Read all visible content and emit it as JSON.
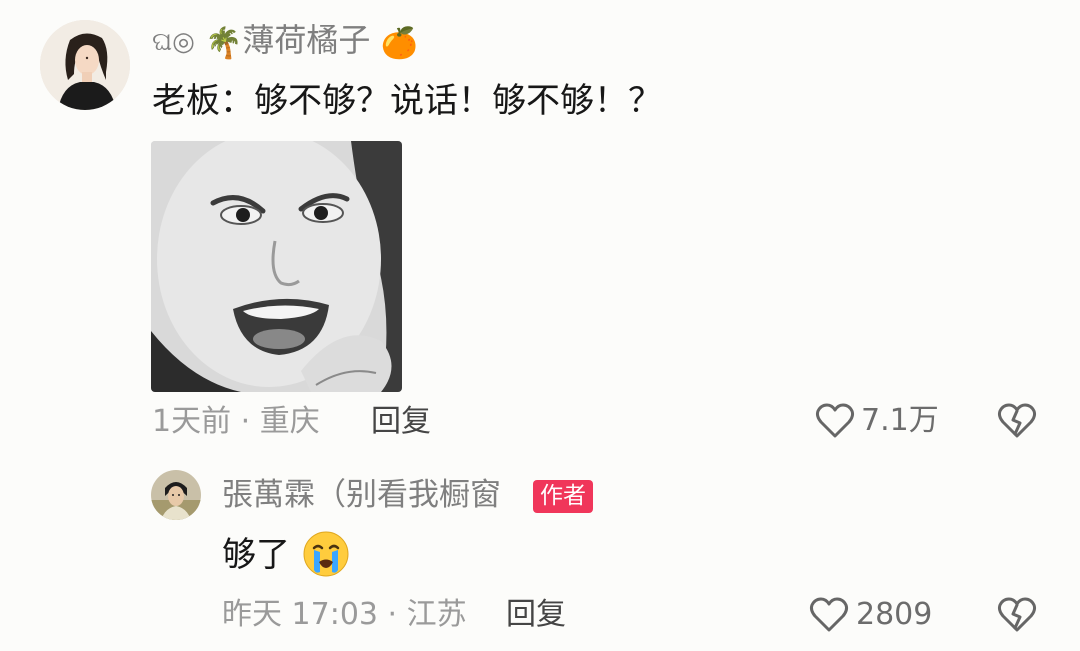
{
  "comment": {
    "username": "薄荷橘子",
    "username_prefix": "ଘ◎",
    "username_emoji_before": "🌴",
    "username_emoji_after": "🍊",
    "text": "老板：够不够？说话！够不够！？",
    "meta": "1天前 · 重庆",
    "reply_label": "回复",
    "likes": "7.1万",
    "sticker_name": "meme sticker face"
  },
  "reply": {
    "username": "張萬霖（别看我橱窗",
    "author_badge": "作者",
    "text": "够了",
    "meta": "昨天 17:03 · 江苏",
    "reply_label": "回复",
    "likes": "2809"
  },
  "colors": {
    "badge": "#f0365a",
    "meta_gray": "#9a9a9a",
    "username_gray": "#7f7f7f",
    "text_dark": "#171717"
  },
  "icons": [
    "heart-icon",
    "broken-heart-icon",
    "crying-face-icon",
    "palm-tree-icon",
    "tangerine-icon"
  ]
}
